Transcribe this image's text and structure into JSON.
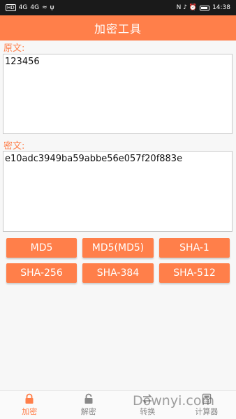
{
  "status_bar": {
    "left_badge": "HD",
    "network_1": "4G",
    "network_2": "4G",
    "wifi": "≈",
    "usb": "ψ",
    "right_icons": "N ♪ ⏰",
    "time": "14:38"
  },
  "app_bar": {
    "title": "加密工具"
  },
  "source": {
    "label": "原文:",
    "value": "123456"
  },
  "cipher": {
    "label": "密文:",
    "value": "e10adc3949ba59abbe56e057f20f883e"
  },
  "buttons": {
    "md5": "MD5",
    "md5_md5": "MD5(MD5)",
    "sha1": "SHA-1",
    "sha256": "SHA-256",
    "sha384": "SHA-384",
    "sha512": "SHA-512"
  },
  "nav": [
    {
      "label": "加密",
      "icon": "lock-icon",
      "active": true
    },
    {
      "label": "解密",
      "icon": "unlock-icon",
      "active": false
    },
    {
      "label": "转换",
      "icon": "swap-icon",
      "active": false
    },
    {
      "label": "计算器",
      "icon": "calculator-icon",
      "active": false
    }
  ],
  "watermark": "Downyi.com",
  "colors": {
    "accent": "#ff7f4a",
    "status_bar": "#1a1a1a",
    "inactive": "#888888"
  }
}
